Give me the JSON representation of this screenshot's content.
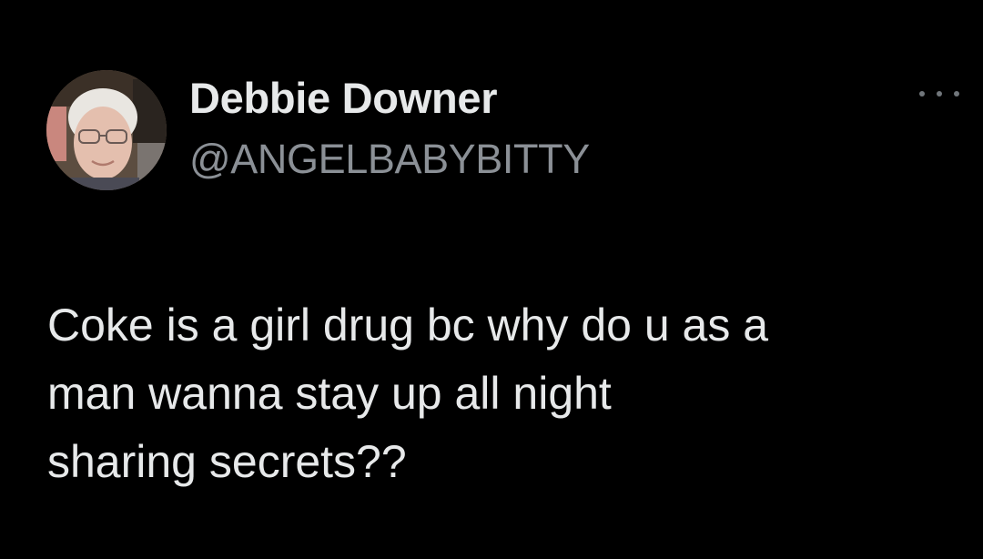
{
  "author": {
    "display_name": "Debbie Downer",
    "handle": "@ANGELBABYBITTY"
  },
  "tweet": {
    "text_lines": [
      "Coke is a girl drug bc why do u as a",
      "man wanna stay up all night",
      "sharing secrets??"
    ]
  },
  "icons": {
    "more": "more-options-icon"
  },
  "colors": {
    "background": "#000000",
    "primary_text": "#e7e9ea",
    "secondary_text": "#8b9096"
  }
}
